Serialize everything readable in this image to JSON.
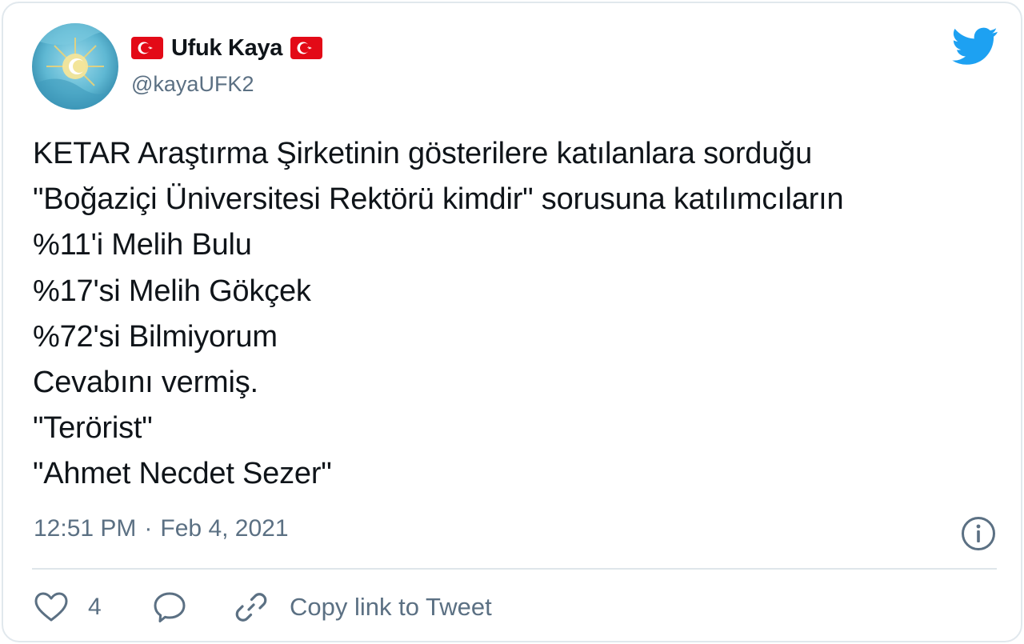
{
  "user": {
    "display_name": "Ufuk Kaya",
    "handle": "@kayaUFK2",
    "flag_emoji": "turkey-flag",
    "flag_color": "#e30a17"
  },
  "tweet": {
    "lines": [
      "KETAR Araştırma Şirketinin gösterilere katılanlara sorduğu",
      "\"Boğaziçi Üniversitesi Rektörü kimdir\" sorusuna katılımcıların",
      "%11'i Melih Bulu",
      "%17'si Melih Gökçek",
      "%72'si Bilmiyorum",
      "Cevabını vermiş.",
      "\"Terörist\"",
      "\"Ahmet Necdet Sezer\""
    ],
    "time": "12:51 PM",
    "separator": "·",
    "date": "Feb 4, 2021"
  },
  "actions": {
    "like_count": "4",
    "copy_link_label": "Copy link to Tweet"
  },
  "colors": {
    "twitter_blue": "#1da1f2",
    "muted_text": "#5b7083",
    "border": "#e1e8ed"
  }
}
